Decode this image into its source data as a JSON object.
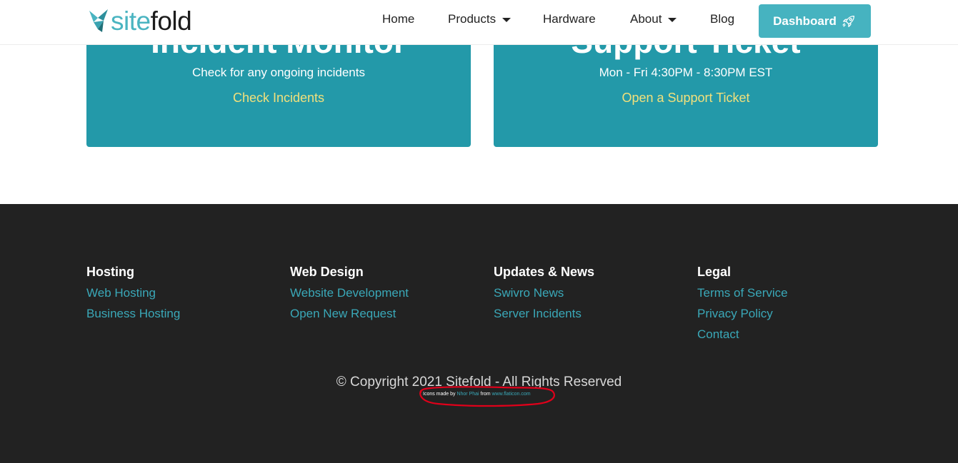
{
  "header": {
    "logo_site": "site",
    "logo_fold": "fold",
    "nav": {
      "home": "Home",
      "products": "Products",
      "hardware": "Hardware",
      "about": "About",
      "blog": "Blog"
    },
    "dashboard": "Dashboard"
  },
  "cards": [
    {
      "title": "Incident Monitor",
      "description": "Check for any ongoing incidents",
      "link": "Check Incidents"
    },
    {
      "title": "Support Ticket",
      "description": "Mon - Fri 4:30PM - 8:30PM EST",
      "link": "Open a Support Ticket"
    }
  ],
  "footer": {
    "columns": [
      {
        "heading": "Hosting",
        "links": [
          "Web Hosting",
          "Business Hosting"
        ]
      },
      {
        "heading": "Web Design",
        "links": [
          "Website Development",
          "Open New Request"
        ]
      },
      {
        "heading": "Updates & News",
        "links": [
          "Swivro News",
          "Server Incidents"
        ]
      },
      {
        "heading": "Legal",
        "links": [
          "Terms of Service",
          "Privacy Policy",
          "Contact"
        ]
      }
    ],
    "copyright": "© Copyright 2021 Sitefold - All Rights Reserved",
    "credit": {
      "prefix": "Icons made by ",
      "author": "Nhor Phai",
      "middle": " from ",
      "site": "www.flaticon.com"
    }
  },
  "colors": {
    "brand": "#46b3c0",
    "card": "#2399a9",
    "card_link": "#f1e07c",
    "footer_bg": "#222222",
    "footer_link": "#3aa8b8",
    "annotation": "#e0001a"
  },
  "icons": {
    "logo": "origami-bird-icon",
    "dashboard": "rocket-icon",
    "dropdown": "caret-down-icon"
  }
}
